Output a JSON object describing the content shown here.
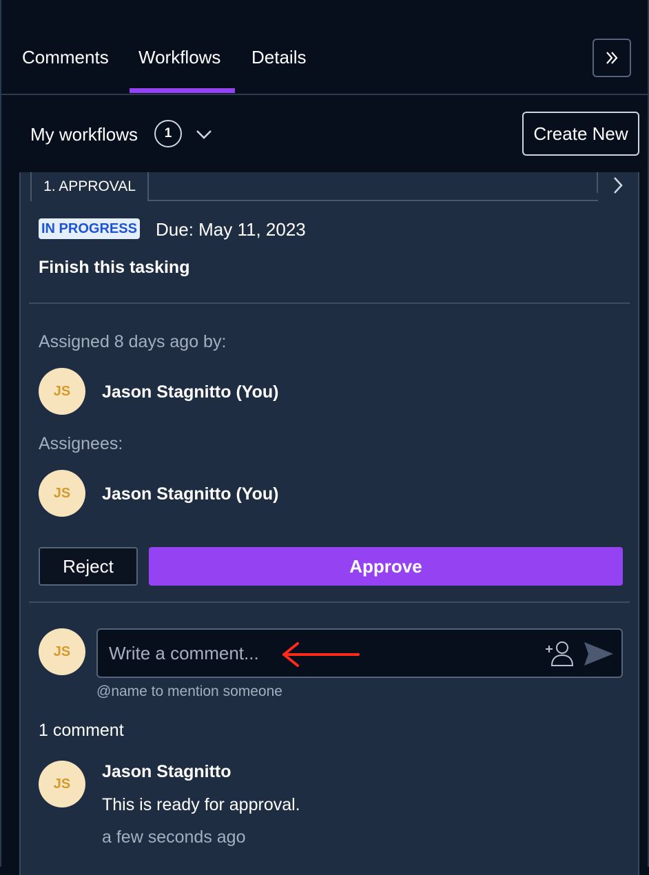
{
  "tabs": [
    {
      "label": "Comments",
      "active": false
    },
    {
      "label": "Workflows",
      "active": true
    },
    {
      "label": "Details",
      "active": false
    }
  ],
  "accent_color": "#9442f2",
  "workflows": {
    "title": "My workflows",
    "count": "1",
    "create_label": "Create New"
  },
  "step": {
    "label": "1. APPROVAL"
  },
  "task": {
    "status": "IN PROGRESS",
    "due": "Due: May 11, 2023",
    "title": "Finish this tasking",
    "assigned_label": "Assigned 8 days ago by:",
    "assigner": {
      "initials": "JS",
      "name": "Jason Stagnitto (You)"
    },
    "assignees_label": "Assignees:",
    "assignees": [
      {
        "initials": "JS",
        "name": "Jason Stagnitto (You)"
      }
    ],
    "reject_label": "Reject",
    "approve_label": "Approve"
  },
  "comment_composer": {
    "avatar_initials": "JS",
    "placeholder": "Write a comment...",
    "hint": "@name to mention someone"
  },
  "comments": {
    "count_label": "1 comment",
    "items": [
      {
        "initials": "JS",
        "author": "Jason Stagnitto",
        "text": "This is ready for approval.",
        "time": "a few seconds ago"
      }
    ]
  }
}
